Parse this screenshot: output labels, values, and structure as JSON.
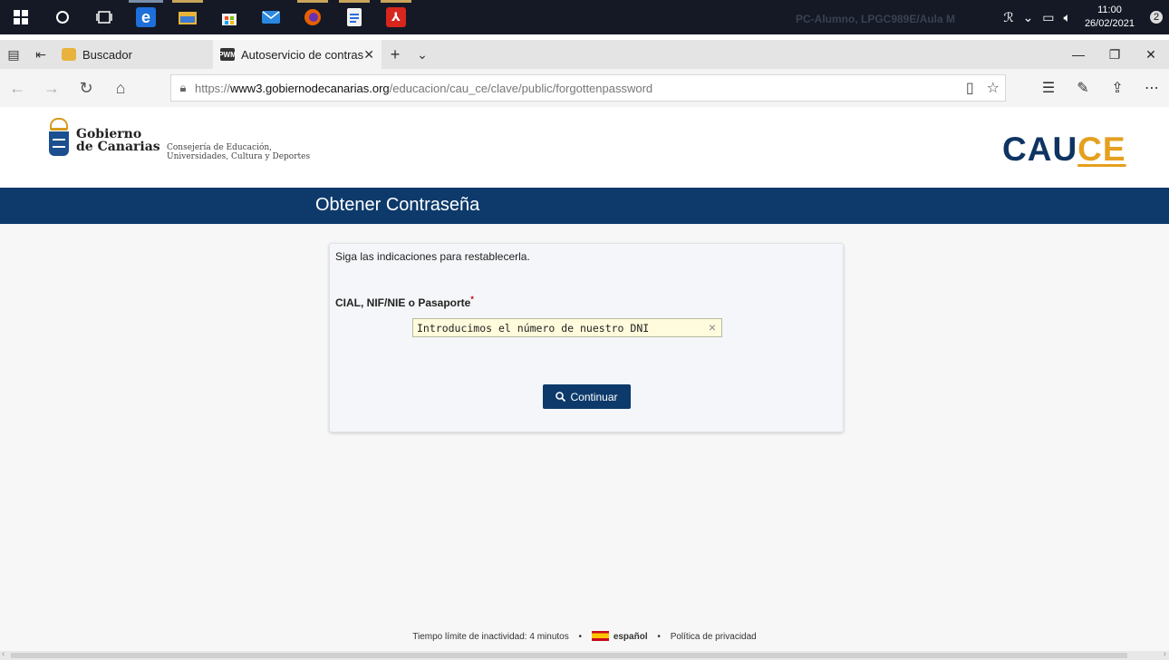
{
  "taskbar": {
    "watermark": "PC-Alumno, LPGC989E/Aula M",
    "time": "11:00",
    "date": "26/02/2021",
    "notifications": "2",
    "colors": {
      "edge": "#1e6fd9",
      "explorer": "#e9b43a",
      "store": "#f0f0f0",
      "mail": "#2a88e0",
      "firefox": "#e66000",
      "notes": "#2a6fe0",
      "acrobat": "#d7261e"
    }
  },
  "browser": {
    "tabs": [
      {
        "label": "Buscador"
      },
      {
        "label": "Autoservicio de contras"
      }
    ],
    "url": {
      "prefix": "https://",
      "host": "www3.gobiernodecanarias.org",
      "path": "/educacion/cau_ce/clave/public/forgottenpassword"
    }
  },
  "header": {
    "gov_name_line1": "Gobierno",
    "gov_name_line2": "de Canarias",
    "dept_line1": "Consejería de Educación,",
    "dept_line2": "Universidades, Cultura y Deportes",
    "brand_a": "CAU",
    "brand_b": "CE"
  },
  "page": {
    "title": "Obtener Contraseña",
    "instructions": "Siga las indicaciones para restablecerla.",
    "field_label": "CIAL, NIF/NIE o Pasaporte",
    "field_required_mark": "*",
    "field_value": "Introducimos el número de nuestro DNI",
    "button_label": "Continuar"
  },
  "footer": {
    "timeout": "Tiempo límite de inactividad: 4 minutos",
    "language": "español",
    "privacy": "Política de privacidad"
  }
}
